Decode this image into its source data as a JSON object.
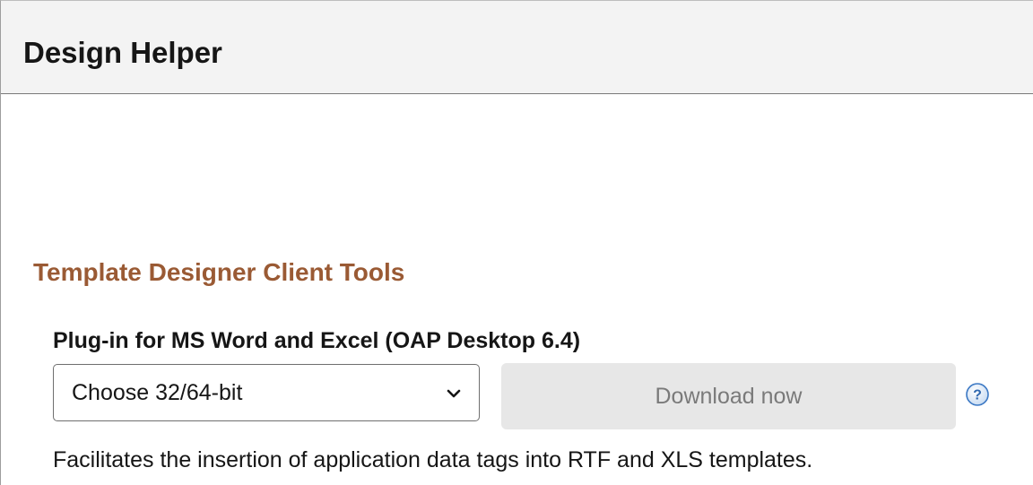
{
  "header": {
    "title": "Design Helper"
  },
  "section": {
    "title": "Template Designer Client Tools"
  },
  "plugin": {
    "label": "Plug-in for MS Word and Excel (OAP Desktop 6.4)",
    "select": {
      "selected_value": "Choose 32/64-bit",
      "icon": "chevron-down-icon"
    },
    "download_button": {
      "label": "Download now",
      "state": "disabled"
    },
    "help_icon": {
      "glyph": "?",
      "icon": "help-icon"
    },
    "description": "Facilitates the insertion of application data tags into RTF and XLS templates."
  },
  "colors": {
    "header_bg": "#f3f3f3",
    "section_title": "#9a5a34",
    "button_bg_disabled": "#e7e7e7",
    "button_text_disabled": "#7a7a7a",
    "help_icon_fill": "#3b78c4"
  }
}
